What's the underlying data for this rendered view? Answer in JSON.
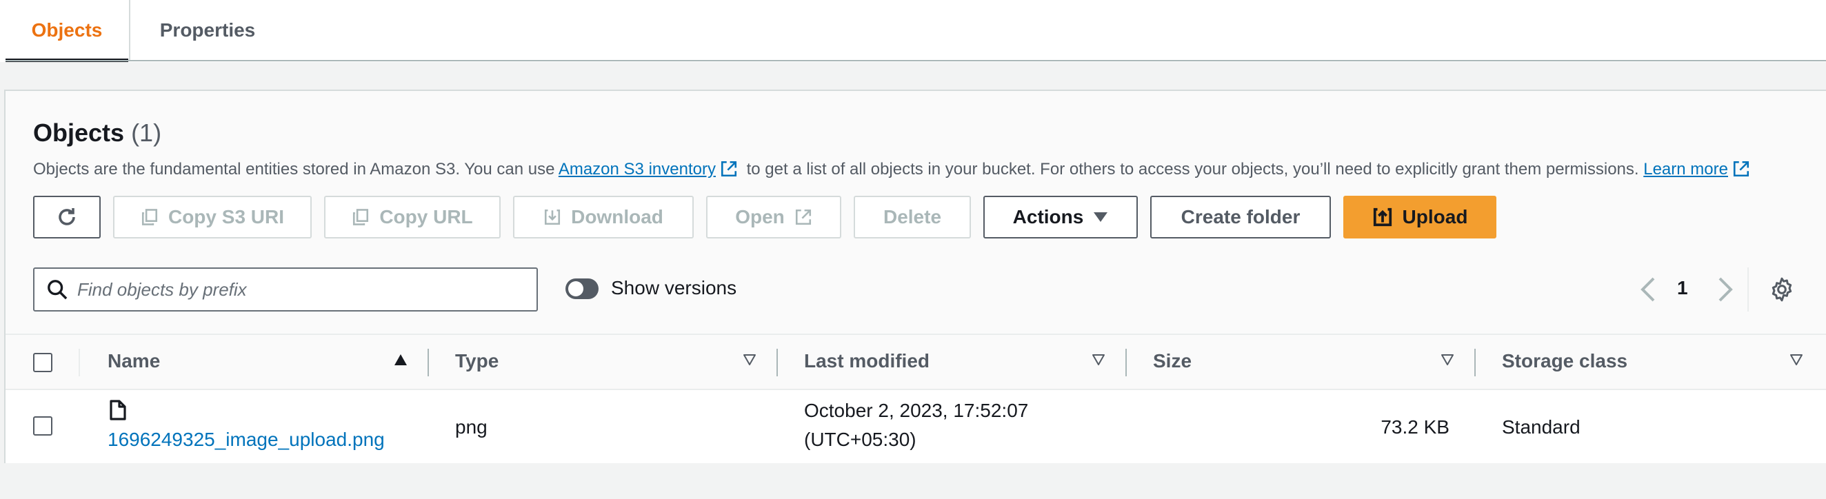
{
  "tabs": [
    {
      "label": "Objects",
      "active": true
    },
    {
      "label": "Properties",
      "active": false
    }
  ],
  "panel": {
    "title": "Objects",
    "count": "(1)",
    "description_before": "Objects are the fundamental entities stored in Amazon S3. You can use",
    "inventory_link": "Amazon S3 inventory",
    "description_middle": "to get a list of all objects in your bucket. For others to access your objects, you’ll need to explicitly grant them permissions.",
    "learn_more_link": "Learn more"
  },
  "toolbar": {
    "refresh_icon": "refresh-icon",
    "copy_s3_uri": "Copy S3 URI",
    "copy_url": "Copy URL",
    "download": "Download",
    "open": "Open",
    "delete": "Delete",
    "actions": "Actions",
    "create_folder": "Create folder",
    "upload": "Upload"
  },
  "search": {
    "placeholder": "Find objects by prefix",
    "value": ""
  },
  "show_versions": {
    "label": "Show versions",
    "enabled": false
  },
  "pagination": {
    "current_page": "1"
  },
  "table": {
    "columns": [
      "Name",
      "Type",
      "Last modified",
      "Size",
      "Storage class"
    ],
    "rows": [
      {
        "name": "1696249325_image_upload.png",
        "type": "png",
        "last_modified_line1": "October 2, 2023, 17:52:07",
        "last_modified_line2": "(UTC+05:30)",
        "size": "73.2 KB",
        "storage_class": "Standard"
      }
    ]
  },
  "colors": {
    "accent": "#ec7211",
    "link": "#0073bb",
    "primary_button": "#f39e2f",
    "disabled_text": "#aab7b8"
  }
}
